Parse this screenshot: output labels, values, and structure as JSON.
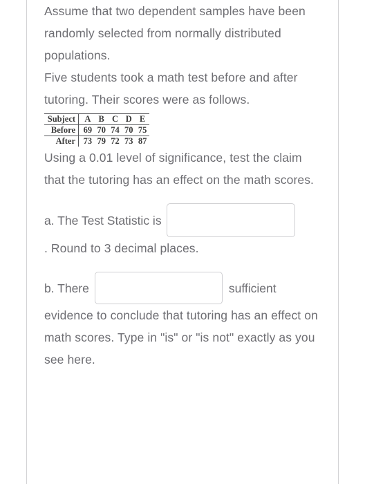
{
  "question": {
    "paragraphs": {
      "assumption": "Assume that two dependent samples have been randomly selected from normally distributed populations.",
      "setup": "Five students took a math test before and after tutoring. Their scores were as follows.",
      "task": "Using a 0.01 level of significance, test the claim that the tutoring has an effect on the math scores.",
      "round_note": ".  Round to 3 decimal places.",
      "conclusion": "evidence to conclude that tutoring has an effect on math scores.  Type in \"is\" or \"is not\" exactly as you see here."
    },
    "scores_table": {
      "header_label": "Subject",
      "subjects": [
        "A",
        "B",
        "C",
        "D",
        "E"
      ],
      "rows": [
        {
          "label": "Before",
          "values": [
            "69",
            "70",
            "74",
            "70",
            "75"
          ]
        },
        {
          "label": "After",
          "values": [
            "73",
            "79",
            "72",
            "73",
            "87"
          ]
        }
      ]
    },
    "part_a": {
      "label": "a. The Test Statistic is",
      "input_value": "",
      "input_placeholder": ""
    },
    "part_b": {
      "label_before": "b. There",
      "label_after": "sufficient",
      "input_value": "",
      "input_placeholder": ""
    }
  },
  "colors": {
    "text": "#6e6e73",
    "table_text": "#3b3b3b",
    "rule": "#d2d2d4",
    "input_border": "#cfcfd2",
    "background": "#ffffff"
  }
}
